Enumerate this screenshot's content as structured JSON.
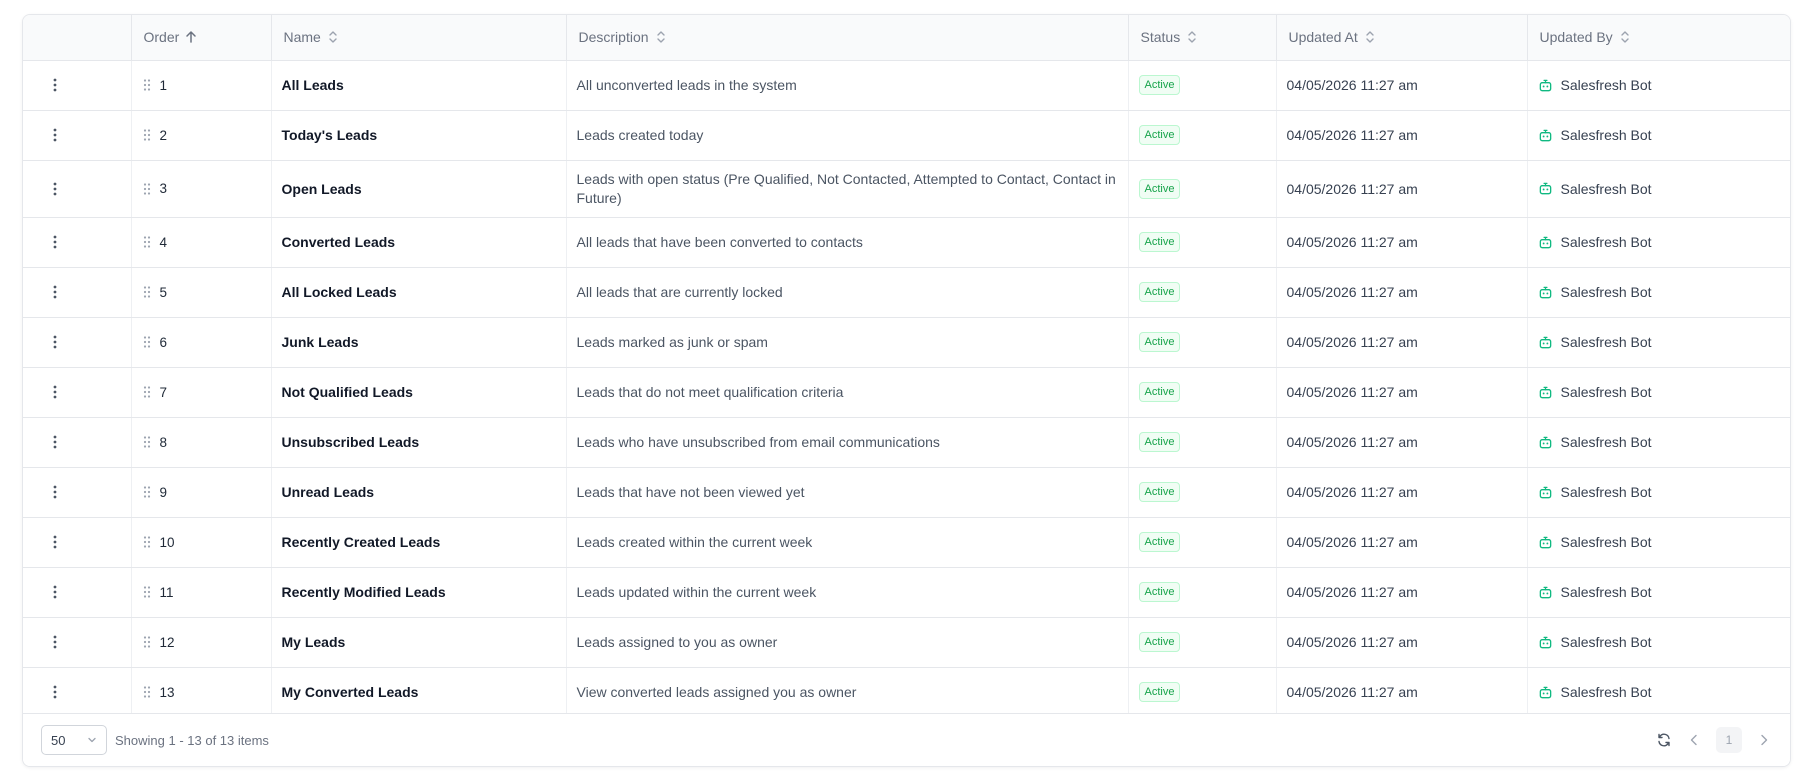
{
  "columns": {
    "order": "Order",
    "name": "Name",
    "description": "Description",
    "status": "Status",
    "updated_at": "Updated At",
    "updated_by": "Updated By"
  },
  "rows": [
    {
      "order": "1",
      "name": "All Leads",
      "description": "All unconverted leads in the system",
      "status": "Active",
      "updated_at": "04/05/2026 11:27 am",
      "updated_by": "Salesfresh Bot"
    },
    {
      "order": "2",
      "name": "Today's Leads",
      "description": "Leads created today",
      "status": "Active",
      "updated_at": "04/05/2026 11:27 am",
      "updated_by": "Salesfresh Bot"
    },
    {
      "order": "3",
      "name": "Open Leads",
      "description": "Leads with open status (Pre Qualified, Not Contacted, Attempted to Contact, Contact in Future)",
      "status": "Active",
      "updated_at": "04/05/2026 11:27 am",
      "updated_by": "Salesfresh Bot"
    },
    {
      "order": "4",
      "name": "Converted Leads",
      "description": "All leads that have been converted to contacts",
      "status": "Active",
      "updated_at": "04/05/2026 11:27 am",
      "updated_by": "Salesfresh Bot"
    },
    {
      "order": "5",
      "name": "All Locked Leads",
      "description": "All leads that are currently locked",
      "status": "Active",
      "updated_at": "04/05/2026 11:27 am",
      "updated_by": "Salesfresh Bot"
    },
    {
      "order": "6",
      "name": "Junk Leads",
      "description": "Leads marked as junk or spam",
      "status": "Active",
      "updated_at": "04/05/2026 11:27 am",
      "updated_by": "Salesfresh Bot"
    },
    {
      "order": "7",
      "name": "Not Qualified Leads",
      "description": "Leads that do not meet qualification criteria",
      "status": "Active",
      "updated_at": "04/05/2026 11:27 am",
      "updated_by": "Salesfresh Bot"
    },
    {
      "order": "8",
      "name": "Unsubscribed Leads",
      "description": "Leads who have unsubscribed from email communications",
      "status": "Active",
      "updated_at": "04/05/2026 11:27 am",
      "updated_by": "Salesfresh Bot"
    },
    {
      "order": "9",
      "name": "Unread Leads",
      "description": "Leads that have not been viewed yet",
      "status": "Active",
      "updated_at": "04/05/2026 11:27 am",
      "updated_by": "Salesfresh Bot"
    },
    {
      "order": "10",
      "name": "Recently Created Leads",
      "description": "Leads created within the current week",
      "status": "Active",
      "updated_at": "04/05/2026 11:27 am",
      "updated_by": "Salesfresh Bot"
    },
    {
      "order": "11",
      "name": "Recently Modified Leads",
      "description": "Leads updated within the current week",
      "status": "Active",
      "updated_at": "04/05/2026 11:27 am",
      "updated_by": "Salesfresh Bot"
    },
    {
      "order": "12",
      "name": "My Leads",
      "description": "Leads assigned to you as owner",
      "status": "Active",
      "updated_at": "04/05/2026 11:27 am",
      "updated_by": "Salesfresh Bot"
    },
    {
      "order": "13",
      "name": "My Converted Leads",
      "description": "View converted leads assigned you as owner",
      "status": "Active",
      "updated_at": "04/05/2026 11:27 am",
      "updated_by": "Salesfresh Bot"
    }
  ],
  "footer": {
    "page_size": "50",
    "showing": "Showing 1 - 13 of 13 items",
    "current_page": "1"
  },
  "icons": {
    "sort_active": "arrow-up-icon",
    "sort": "chevron-up-down-icon",
    "row_menu": "kebab-menu-icon",
    "drag": "drag-handle-icon",
    "bot": "bot-icon",
    "refresh": "refresh-icon",
    "prev": "chevron-left-icon",
    "next": "chevron-right-icon"
  },
  "colors": {
    "status_active_text": "#16a34a",
    "status_active_bg": "#f0fdf4",
    "bot_icon": "#10b981"
  }
}
